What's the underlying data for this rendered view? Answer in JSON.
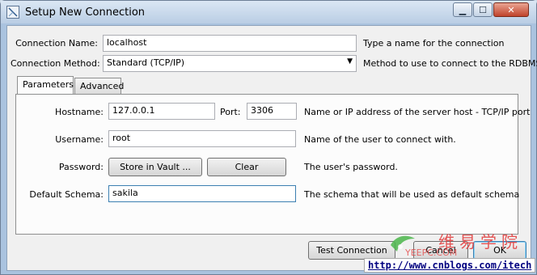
{
  "window": {
    "title": "Setup New Connection"
  },
  "titlebar": {
    "min": "▁",
    "max": "☐",
    "close": "✕"
  },
  "connection": {
    "name_label": "Connection Name:",
    "name_value": "localhost",
    "name_help": "Type a name for the connection",
    "method_label": "Connection Method:",
    "method_value": "Standard (TCP/IP)",
    "method_help": "Method to use to connect to the RDBMS"
  },
  "tabs": [
    {
      "label": "Parameters"
    },
    {
      "label": "Advanced"
    }
  ],
  "params": {
    "hostname_label": "Hostname:",
    "hostname_value": "127.0.0.1",
    "port_label": "Port:",
    "port_value": "3306",
    "hostname_help": "Name or IP address of the server host - TCP/IP port",
    "username_label": "Username:",
    "username_value": "root",
    "username_help": "Name of the user to connect with.",
    "password_label": "Password:",
    "store_vault": "Store in Vault ...",
    "clear": "Clear",
    "password_help": "The user's password.",
    "schema_label": "Default Schema:",
    "schema_value": "sakila",
    "schema_help": "The schema that will be used as default schema"
  },
  "footer": {
    "test": "Test Connection",
    "cancel": "Cancel",
    "ok": "OK"
  },
  "watermark": {
    "chinese": "维易学院",
    "site": "YEEPC.COM",
    "url": "http://www.cnblogs.com/itech"
  }
}
